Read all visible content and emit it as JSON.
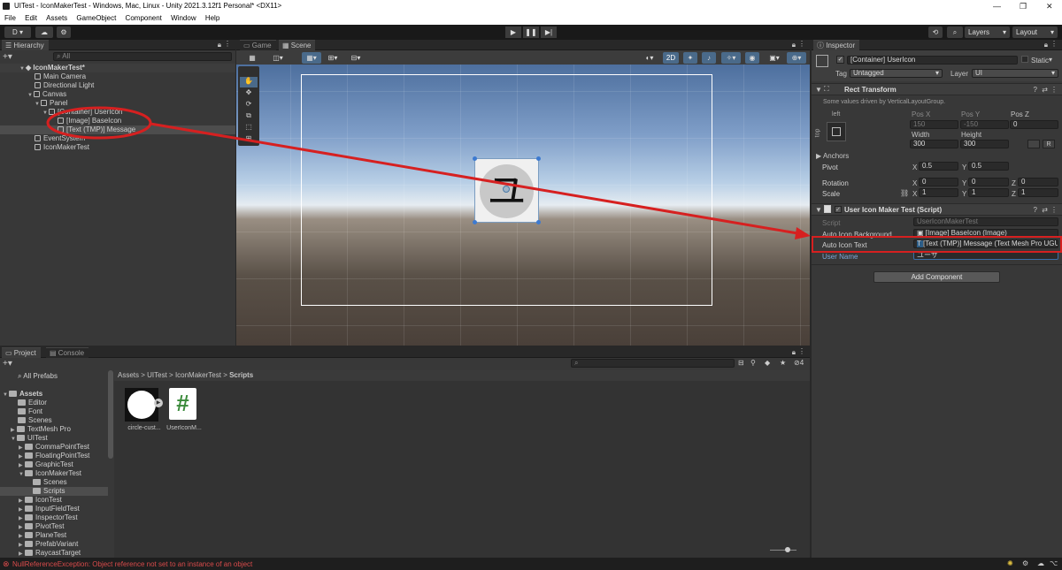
{
  "window": {
    "title": "UITest - IconMakerTest - Windows, Mac, Linux - Unity 2021.3.12f1 Personal* <DX11>"
  },
  "menu": [
    "File",
    "Edit",
    "Assets",
    "GameObject",
    "Component",
    "Window",
    "Help"
  ],
  "toolbar": {
    "account": "D",
    "layers": "Layers",
    "layout": "Layout"
  },
  "hierarchy": {
    "tab": "Hierarchy",
    "search_placeholder": "All",
    "scene": "IconMakerTest*",
    "items": [
      {
        "label": "Main Camera"
      },
      {
        "label": "Directional Light"
      },
      {
        "label": "Canvas"
      },
      {
        "label": "Panel"
      },
      {
        "label": "[Container] UserIcon"
      },
      {
        "label": "[Image] BaseIcon"
      },
      {
        "label": "[Text (TMP)] Message"
      },
      {
        "label": "EventSystem"
      },
      {
        "label": "IconMakerTest"
      }
    ]
  },
  "scene_view": {
    "tabs": [
      "Game",
      "Scene"
    ],
    "mode_2d": "2D",
    "icon_glyph": "ユ",
    "gizmo_count": "4"
  },
  "inspector": {
    "tab": "Inspector",
    "object_name": "[Container] UserIcon",
    "static_label": "Static",
    "tag_label": "Tag",
    "tag_value": "Untagged",
    "layer_label": "Layer",
    "layer_value": "UI",
    "rect_transform": {
      "title": "Rect Transform",
      "note": "Some values driven by VerticalLayoutGroup.",
      "anchor_h": "left",
      "anchor_v": "top",
      "pos_x_label": "Pos X",
      "pos_y_label": "Pos Y",
      "pos_z_label": "Pos Z",
      "pos_x": "150",
      "pos_y": "-150",
      "pos_z": "0",
      "width_label": "Width",
      "height_label": "Height",
      "width": "300",
      "height": "300",
      "anchors_label": "Anchors",
      "pivot_label": "Pivot",
      "pivot_x": "0.5",
      "pivot_y": "0.5",
      "rotation_label": "Rotation",
      "rot_x": "0",
      "rot_y": "0",
      "rot_z": "0",
      "scale_label": "Scale",
      "scale_x": "1",
      "scale_y": "1",
      "scale_z": "1",
      "x": "X",
      "y": "Y",
      "z": "Z",
      "r": "R"
    },
    "script_component": {
      "title": "User Icon Maker Test (Script)",
      "script_label": "Script",
      "script_value": "UserIconMakerTest",
      "auto_icon_bg_label": "Auto Icon Background",
      "auto_icon_bg_value": "[Image] BaseIcon (Image)",
      "auto_icon_text_label": "Auto Icon Text",
      "auto_icon_text_value": "[Text (TMP)] Message (Text Mesh Pro UGUI)",
      "user_name_label": "User Name",
      "user_name_value": "ユーザ"
    },
    "add_component": "Add Component"
  },
  "project": {
    "tabs": [
      "Project",
      "Console"
    ],
    "favorites": [
      "All Prefabs"
    ],
    "tree": [
      {
        "label": "Assets"
      },
      {
        "label": "Editor"
      },
      {
        "label": "Font"
      },
      {
        "label": "Scenes"
      },
      {
        "label": "TextMesh Pro"
      },
      {
        "label": "UITest"
      },
      {
        "label": "CommaPointTest"
      },
      {
        "label": "FloatingPointTest"
      },
      {
        "label": "GraphicTest"
      },
      {
        "label": "IconMakerTest"
      },
      {
        "label": "Scenes"
      },
      {
        "label": "Scripts"
      },
      {
        "label": "IconTest"
      },
      {
        "label": "InputFieldTest"
      },
      {
        "label": "InspectorTest"
      },
      {
        "label": "PivotTest"
      },
      {
        "label": "PlaneTest"
      },
      {
        "label": "PrefabVariant"
      },
      {
        "label": "RaycastTarget"
      }
    ],
    "breadcrumb": [
      "Assets",
      "UITest",
      "IconMakerTest",
      "Scripts"
    ],
    "assets": [
      {
        "label": "circle-cust...",
        "icon": "circle-texture-icon"
      },
      {
        "label": "UserIconM...",
        "icon": "csharp-script-icon"
      }
    ],
    "script_glyph": "#"
  },
  "status": {
    "error": "NullReferenceException: Object reference not set to an instance of an object"
  },
  "colors": {
    "annotation": "#d62020",
    "error": "#d94b4b",
    "selection": "#2c5d87"
  }
}
